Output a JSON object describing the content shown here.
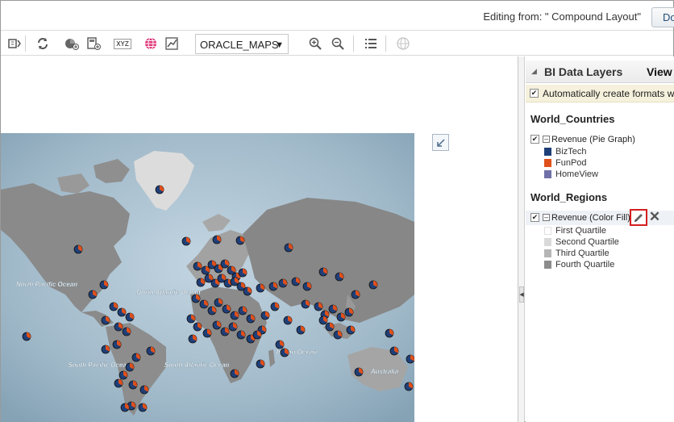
{
  "header": {
    "editing_from": "Editing from: \" Compound Layout\"",
    "done_label": "Done"
  },
  "toolbar": {
    "icons": [
      "properties-icon",
      "refresh-icon",
      "add-layer-icon",
      "calculator-icon",
      "xyz-icon",
      "globe-icon",
      "chart-edit-icon",
      "zoom-in-icon",
      "zoom-out-icon",
      "list-icon",
      "globe-disabled-icon"
    ],
    "xyz_text": "XYZ",
    "map_select_value": "ORACLE_MAPS"
  },
  "map": {
    "ocean_labels": [
      {
        "text": "North Pacific Ocean"
      },
      {
        "text": "North Atlantic Ocean"
      },
      {
        "text": "South Pacific Ocean"
      },
      {
        "text": "South Atlantic Ocean"
      },
      {
        "text": "Indian Ocean"
      },
      {
        "text": "Australia"
      }
    ],
    "colors": {
      "ocean": "#9fb8c8",
      "land": "#8c8c8c",
      "greenland": "#d8d8d8",
      "pie_blue": "#1f3f78",
      "pie_orange": "#e0501b"
    }
  },
  "panel": {
    "title": "BI Data Layers",
    "view_label": "View",
    "auto_format_label": "Automatically create formats w",
    "groups": [
      {
        "title": "World_Countries",
        "layer_label": "Revenue (Pie Graph)",
        "legend": [
          {
            "label": "BizTech",
            "color": "#1f3f78"
          },
          {
            "label": "FunPod",
            "color": "#e0501b"
          },
          {
            "label": "HomeView",
            "color": "#7070a8"
          }
        ]
      },
      {
        "title": "World_Regions",
        "layer_label": "Revenue (Color Fill)",
        "legend": [
          {
            "label": "First Quartile",
            "color": "#ffffff"
          },
          {
            "label": "Second Quartile",
            "color": "#d9d9d9"
          },
          {
            "label": "Third Quartile",
            "color": "#b5b5b5"
          },
          {
            "label": "Fourth Quartile",
            "color": "#8c8c8c"
          }
        ]
      }
    ]
  }
}
